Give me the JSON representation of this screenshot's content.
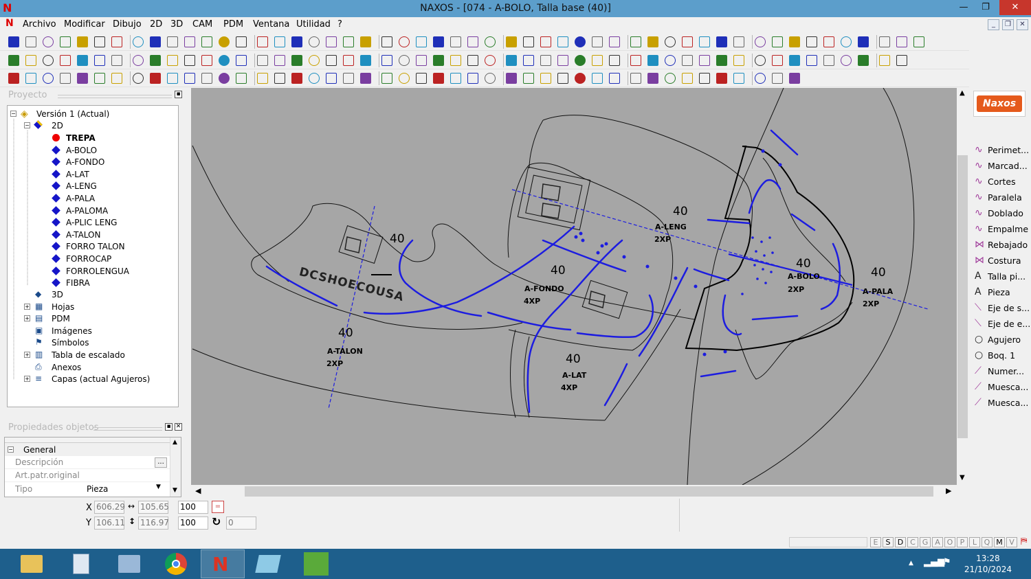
{
  "window": {
    "title": "NAXOS - [074 - A-BOLO, Talla base (40)]",
    "logo": "N",
    "min": "—",
    "max": "❐",
    "close": "✕"
  },
  "menu": [
    "Archivo",
    "Modificar",
    "Dibujo",
    "2D",
    "3D",
    "CAM",
    "PDM",
    "Ventana",
    "Utilidad",
    "?"
  ],
  "mdi_buttons": [
    "_",
    "❐",
    "✕"
  ],
  "project": {
    "title": "Proyecto",
    "root": "Versión 1 (Actual)",
    "node_2d": "2D",
    "pieces": [
      "TREPA",
      "A-BOLO",
      "A-FONDO",
      "A-LAT",
      "A-LENG",
      "A-PALA",
      "A-PALOMA",
      "A-PLIC LENG",
      "A-TALON",
      "FORRO TALON",
      "FORROCAP",
      "FORROLENGUA",
      "FIBRA"
    ],
    "active_piece": "TREPA",
    "others": [
      "3D",
      "Hojas",
      "PDM",
      "Imágenes",
      "Símbolos",
      "Tabla de escalado",
      "Anexos",
      "Capas (actual Agujeros)"
    ]
  },
  "props": {
    "title": "Propiedades objetos",
    "section": "General",
    "rows": [
      {
        "label": "Descripción",
        "value": "",
        "btn": "..."
      },
      {
        "label": "Art.patr.original",
        "value": ""
      },
      {
        "label": "Tipo",
        "value": "Pieza"
      }
    ]
  },
  "canvas": {
    "logo_text": "DCSHOECOUSA",
    "labels": [
      {
        "size": "40",
        "name": "A-LENG",
        "qty": "2XP"
      },
      {
        "size": "40",
        "name": "A-FONDO",
        "qty": "4XP"
      },
      {
        "size": "40",
        "name": "A-BOLO",
        "qty": "2XP"
      },
      {
        "size": "40",
        "name": "A-PALA",
        "qty": "2XP"
      },
      {
        "size": "40",
        "name": "A-TALON",
        "qty": "2XP"
      },
      {
        "size": "40",
        "name": "A-LAT",
        "qty": "4XP"
      },
      {
        "size": "40",
        "name": ""
      }
    ]
  },
  "brand": "Naxos",
  "right_tools": [
    "Perimet...",
    "Marcad...",
    "Cortes",
    "Paralela",
    "Doblado",
    "Empalme",
    "Rebajado",
    "Costura",
    "Talla pi...",
    "Pieza",
    "Eje de s...",
    "Eje de e...",
    "Agujero",
    "Boq. 1",
    "Numer...",
    "Muesca...",
    "Muesca..."
  ],
  "coords": {
    "x_label": "X",
    "y_label": "Y",
    "x": "606.29",
    "y": "106.11",
    "w": "105.65",
    "h": "116.97",
    "sx": "100",
    "sy": "100",
    "rot": "0"
  },
  "status_letters": [
    "E",
    "S",
    "D",
    "C",
    "G",
    "A",
    "O",
    "P",
    "L",
    "Q",
    "M",
    "V"
  ],
  "clock": {
    "time": "13:28",
    "date": "21/10/2024"
  }
}
